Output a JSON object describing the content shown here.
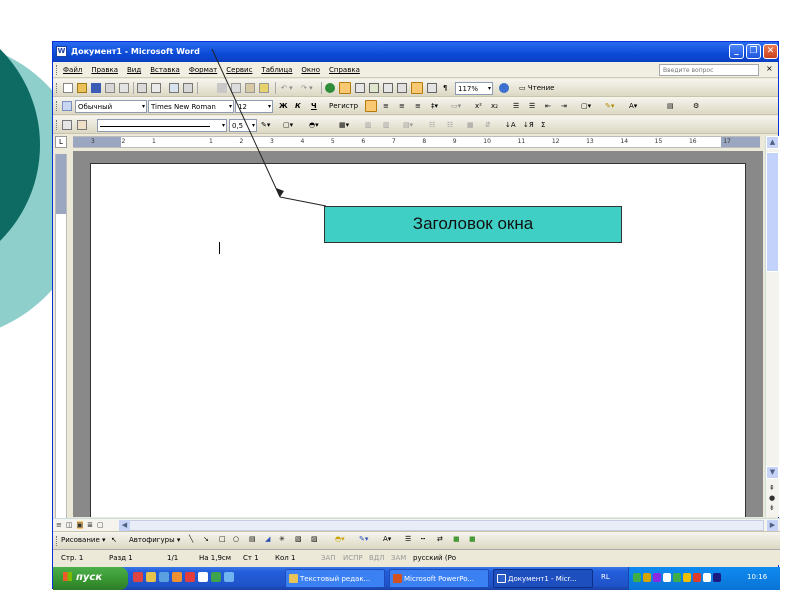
{
  "window": {
    "title": "Документ1 - Microsoft Word",
    "app_icon_letter": "W"
  },
  "menu": {
    "items": [
      "Файл",
      "Правка",
      "Вид",
      "Вставка",
      "Формат",
      "Сервис",
      "Таблица",
      "Окно",
      "Справка"
    ],
    "help_placeholder": "Введите вопрос",
    "close_doc": "×"
  },
  "toolbar_standard": {
    "zoom": "117%",
    "read_label": "Чтение"
  },
  "toolbar_formatting": {
    "style": "Обычный",
    "font": "Times New Roman",
    "size": "12",
    "bold": "Ж",
    "italic": "К",
    "underline": "Ч",
    "case_label": "Регистр"
  },
  "toolbar_tables": {
    "line_weight": "0,5"
  },
  "ruler": {
    "numbers": [
      "3",
      "2",
      "1",
      "",
      "1",
      "2",
      "3",
      "4",
      "5",
      "6",
      "7",
      "8",
      "9",
      "10",
      "11",
      "12",
      "13",
      "14",
      "15",
      "16",
      "17"
    ],
    "corner": "L"
  },
  "drawing_toolbar": {
    "draw_label": "Рисование",
    "autoshapes_label": "Автофигуры"
  },
  "statusbar": {
    "page": "Стр. 1",
    "section": "Разд 1",
    "pages": "1/1",
    "at": "На 1,9см",
    "line": "Ст 1",
    "col": "Кол 1",
    "rec": "ЗАП",
    "trk": "ИСПР",
    "ext": "ВДЛ",
    "ovr": "ЗАМ",
    "language": "русский (Ро"
  },
  "taskbar": {
    "start_label": "пуск",
    "tasks": [
      {
        "label": "Текстовый редак...",
        "active": false
      },
      {
        "label": "Microsoft PowerPo...",
        "active": false
      },
      {
        "label": "Документ1 - Micr...",
        "active": true
      }
    ],
    "lang": "RL",
    "clock": "10:16"
  },
  "callout": {
    "text": "Заголовок окна"
  },
  "colors": {
    "titlebar": "#0a4ad6",
    "callout_fill": "#40cfc4",
    "deco_dark": "#0e6b63",
    "deco_light": "#8fcfcb"
  }
}
